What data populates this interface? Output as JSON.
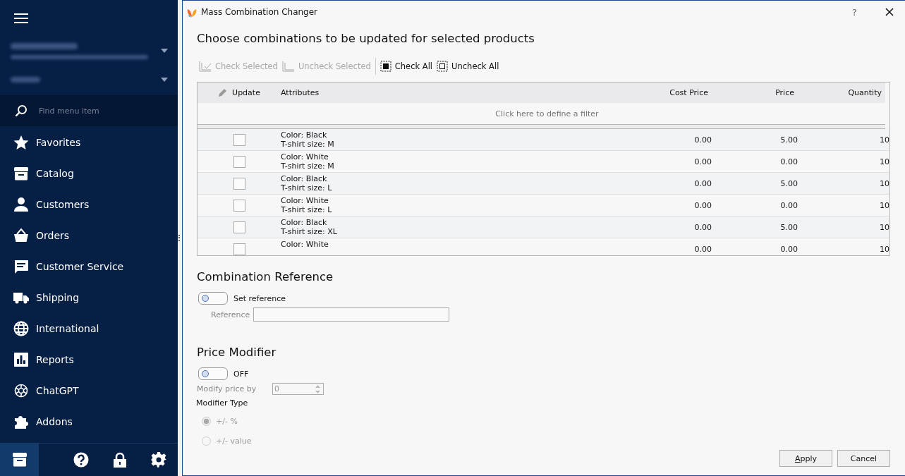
{
  "sidebar": {
    "search": {
      "placeholder": "Find menu item"
    },
    "items": [
      {
        "label": "Favorites",
        "selected": false
      },
      {
        "label": "Catalog",
        "selected": false
      },
      {
        "label": "Customers",
        "selected": false
      },
      {
        "label": "Orders",
        "selected": false
      },
      {
        "label": "Customer Service",
        "selected": false
      },
      {
        "label": "Shipping",
        "selected": false
      },
      {
        "label": "International",
        "selected": false
      },
      {
        "label": "Reports",
        "selected": false
      },
      {
        "label": "ChatGPT",
        "selected": false
      },
      {
        "label": "Addons",
        "selected": false
      }
    ],
    "bottom": [
      {
        "kind": "store",
        "selected": true
      },
      {
        "kind": "help",
        "selected": false
      },
      {
        "kind": "lock",
        "selected": false
      },
      {
        "kind": "settings",
        "selected": false
      }
    ]
  },
  "window": {
    "title": "Mass Combination Changer",
    "help": "?"
  },
  "heading": "Choose combinations to be updated for selected products",
  "toolbar": [
    {
      "label": "Check Selected",
      "kind": "check-selected",
      "disabled": true
    },
    {
      "label": "Uncheck Selected",
      "kind": "uncheck-selected",
      "disabled": true
    },
    {
      "label": "Check All",
      "kind": "check-all",
      "disabled": false
    },
    {
      "label": "Uncheck All",
      "kind": "uncheck-all",
      "disabled": false
    }
  ],
  "table": {
    "columns": [
      "Update",
      "Attributes",
      "Cost Price",
      "Price",
      "Quantity"
    ],
    "filter": "Click here to define a filter",
    "rows": [
      {
        "checked": false,
        "attributes": [
          "Color: Black",
          "T-shirt size: M"
        ],
        "cost_price": "0.00",
        "price": "5.00",
        "quantity": "10"
      },
      {
        "checked": false,
        "attributes": [
          "Color: White",
          "T-shirt size: M"
        ],
        "cost_price": "0.00",
        "price": "0.00",
        "quantity": "10"
      },
      {
        "checked": false,
        "attributes": [
          "Color: Black",
          "T-shirt size: L"
        ],
        "cost_price": "0.00",
        "price": "5.00",
        "quantity": "10"
      },
      {
        "checked": false,
        "attributes": [
          "Color: White",
          "T-shirt size: L"
        ],
        "cost_price": "0.00",
        "price": "0.00",
        "quantity": "10"
      },
      {
        "checked": false,
        "attributes": [
          "Color: Black",
          "T-shirt size: XL"
        ],
        "cost_price": "0.00",
        "price": "5.00",
        "quantity": "10"
      },
      {
        "checked": false,
        "attributes": [
          "Color: White"
        ],
        "cost_price": "0.00",
        "price": "0.00",
        "quantity": "10"
      }
    ]
  },
  "combination_reference": {
    "title": "Combination Reference",
    "toggle": {
      "label": "Set reference",
      "on": false
    },
    "reference_label": "Reference"
  },
  "price_modifier": {
    "title": "Price Modifier",
    "toggle": {
      "label": "OFF",
      "on": false
    },
    "modify_label": "Modify price by",
    "modify_value": "0",
    "type_label": "Modifier Type",
    "options": [
      {
        "label": "+/- %",
        "selected": true
      },
      {
        "label": "+/- value",
        "selected": false
      }
    ]
  },
  "buttons": [
    "Apply",
    "Cancel"
  ]
}
